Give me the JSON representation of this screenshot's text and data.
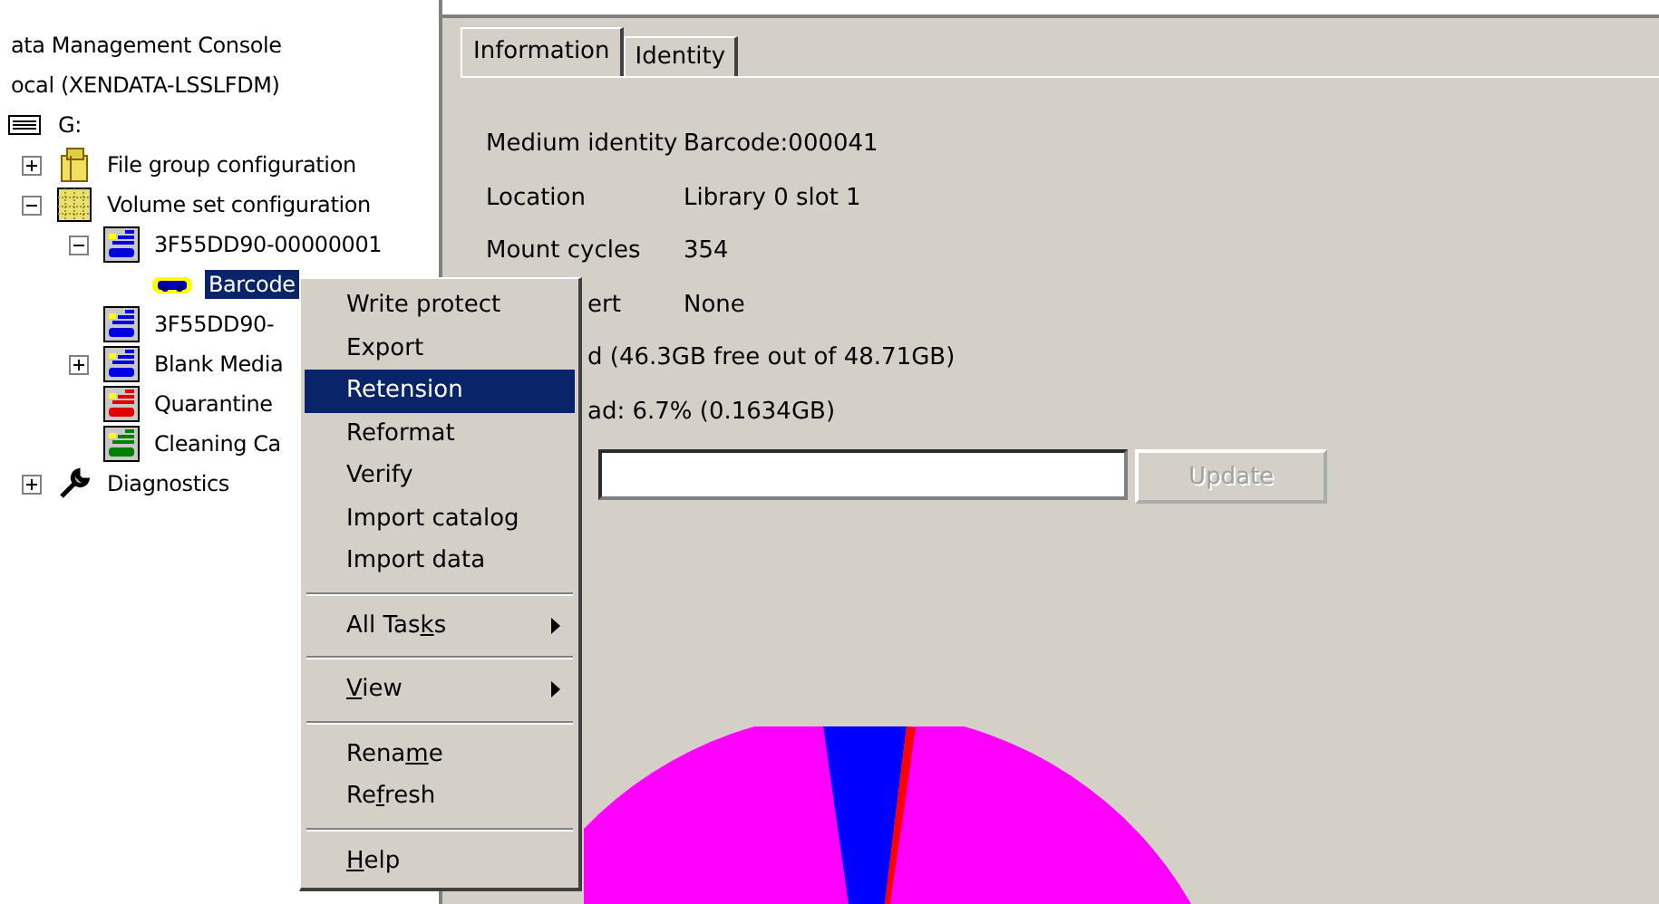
{
  "tree": [
    {
      "label": "ata Management Console",
      "selected": false,
      "children": [
        {
          "label": "ocal (XENDATA-LSSLFDM)",
          "selected": false,
          "children": [
            {
              "label": "G:",
              "kind": "drive",
              "selected": false,
              "children": [
                {
                  "label": "File group configuration",
                  "kind": "folder",
                  "expanded": false,
                  "selected": false
                },
                {
                  "label": "Volume set configuration",
                  "kind": "volume-set",
                  "expanded": true,
                  "selected": false,
                  "children": [
                    {
                      "label": "3F55DD90-00000001",
                      "kind": "volume",
                      "expanded": true,
                      "selected": false,
                      "children": [
                        {
                          "label": "Barcode",
                          "kind": "tape",
                          "selected": true
                        }
                      ]
                    },
                    {
                      "label": "3F55DD90-",
                      "kind": "volume",
                      "selected": false
                    },
                    {
                      "label": "Blank Media",
                      "kind": "volume",
                      "expanded": false,
                      "selected": false
                    },
                    {
                      "label": "Quarantine",
                      "kind": "quarantine",
                      "selected": false
                    },
                    {
                      "label": "Cleaning Ca",
                      "kind": "cleaning",
                      "selected": false
                    }
                  ]
                },
                {
                  "label": "Diagnostics",
                  "kind": "wrench",
                  "expanded": false,
                  "selected": false
                }
              ]
            }
          ]
        }
      ]
    }
  ],
  "tabs": [
    {
      "label": "Information",
      "selected": true
    },
    {
      "label": "Identity",
      "selected": false
    }
  ],
  "info_rows": [
    {
      "kind": "pair",
      "label": "Medium identity",
      "value": "Barcode:000041"
    },
    {
      "kind": "pair",
      "label": "Location",
      "value": "Library 0 slot 1"
    },
    {
      "kind": "pair",
      "label": "Mount cycles",
      "value": "354"
    },
    {
      "kind": "clipped-pair",
      "label": "ert",
      "value": "None"
    },
    {
      "kind": "clipped-line",
      "value": "d (46.3GB free out of 48.71GB)"
    },
    {
      "kind": "clipped-line",
      "value": "ad: 6.7% (0.1634GB)"
    }
  ],
  "update_button": {
    "label": "Update",
    "disabled": true
  },
  "context_menu": [
    {
      "kind": "item",
      "pre": "Write protect",
      "selected": false
    },
    {
      "kind": "item",
      "pre": "Export",
      "selected": false
    },
    {
      "kind": "item",
      "pre": "Retension",
      "selected": true
    },
    {
      "kind": "item",
      "pre": "Reformat",
      "selected": false
    },
    {
      "kind": "item",
      "pre": "Verify",
      "selected": false
    },
    {
      "kind": "item",
      "pre": "Import catalog",
      "selected": false
    },
    {
      "kind": "item",
      "pre": "Import data",
      "selected": false
    },
    {
      "kind": "separator"
    },
    {
      "kind": "submenu",
      "pre": "All Tas",
      "key": "k",
      "post": "s",
      "selected": false
    },
    {
      "kind": "separator"
    },
    {
      "kind": "submenu",
      "key": "V",
      "post": "iew",
      "selected": false
    },
    {
      "kind": "separator"
    },
    {
      "kind": "item",
      "pre": "Rena",
      "key": "m",
      "post": "e",
      "selected": false
    },
    {
      "kind": "item",
      "pre": "Re",
      "key": "f",
      "post": "resh",
      "selected": false
    },
    {
      "kind": "separator"
    },
    {
      "kind": "item",
      "key": "H",
      "post": "elp",
      "selected": false
    }
  ]
}
